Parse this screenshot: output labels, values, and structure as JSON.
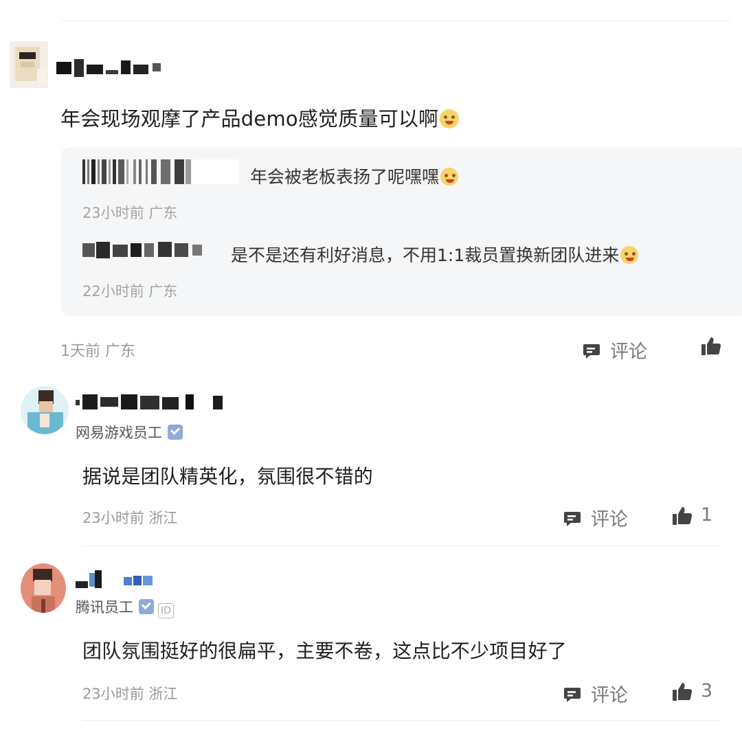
{
  "post1": {
    "text": "年会现场观摩了产品demo感觉质量可以啊",
    "replies": [
      {
        "text": "年会被老板表扬了呢嘿嘿",
        "meta": "23小时前 广东"
      },
      {
        "text": "是不是还有利好消息，不用1:1裁员置换新团队进来",
        "meta": "22小时前 广东"
      }
    ],
    "meta": "1天前 广东",
    "comment_label": "评论",
    "like_count": ""
  },
  "post2": {
    "role": "网易游戏员工",
    "text": "据说是团队精英化，氛围很不错的",
    "meta": "23小时前 浙江",
    "comment_label": "评论",
    "like_count": "1"
  },
  "post3": {
    "role": "腾讯员工",
    "id_badge": "ID",
    "text": "团队氛围挺好的很扁平，主要不卷，这点比不少项目好了",
    "meta": "23小时前 浙江",
    "comment_label": "评论",
    "like_count": "3"
  },
  "icons": {
    "comment": "comment-icon",
    "like": "thumbs-up-icon",
    "verified": "verified-badge-icon"
  },
  "colors": {
    "reply_bg": "#f5f6f8",
    "meta_text": "#9a9a9a",
    "verified_badge": "#8fa9d9"
  }
}
